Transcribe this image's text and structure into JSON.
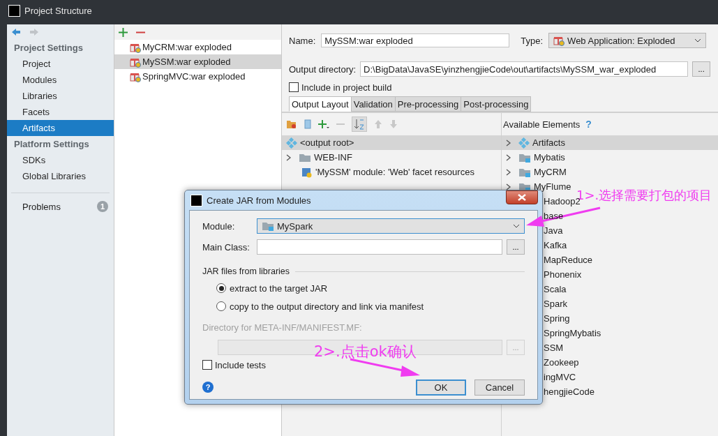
{
  "window": {
    "title": "Project Structure"
  },
  "sidebar": {
    "sections": [
      {
        "heading": "Project Settings",
        "items": [
          {
            "label": "Project",
            "selected": false
          },
          {
            "label": "Modules",
            "selected": false
          },
          {
            "label": "Libraries",
            "selected": false
          },
          {
            "label": "Facets",
            "selected": false
          },
          {
            "label": "Artifacts",
            "selected": true
          }
        ]
      },
      {
        "heading": "Platform Settings",
        "items": [
          {
            "label": "SDKs",
            "selected": false
          },
          {
            "label": "Global Libraries",
            "selected": false
          }
        ]
      }
    ],
    "problems": {
      "label": "Problems",
      "count": "1"
    }
  },
  "artifacts": [
    {
      "label": "MyCRM:war exploded",
      "selected": false
    },
    {
      "label": "MySSM:war exploded",
      "selected": true
    },
    {
      "label": "SpringMVC:war exploded",
      "selected": false
    }
  ],
  "editor": {
    "name_label": "Name:",
    "name": "MySSM:war exploded",
    "type_label": "Type:",
    "type": "Web Application: Exploded",
    "output_label": "Output directory:",
    "output": "D:\\BigData\\JavaSE\\yinzhengjieCode\\out\\artifacts\\MySSM_war_exploded",
    "browse": "...",
    "include_build": {
      "label": "Include in project build",
      "checked": false
    },
    "tabs": [
      {
        "label": "Output Layout",
        "selected": true
      },
      {
        "label": "Validation",
        "selected": false
      },
      {
        "label": "Pre-processing",
        "selected": false
      },
      {
        "label": "Post-processing",
        "selected": false
      }
    ],
    "layout_tree": [
      {
        "label": "<output root>",
        "kind": "root",
        "selected": true
      },
      {
        "label": "WEB-INF",
        "kind": "folder",
        "selected": false
      },
      {
        "label": "'MySSM' module: 'Web' facet resources",
        "kind": "facet",
        "selected": false
      }
    ],
    "available_title": "Available Elements",
    "help": "?",
    "available": [
      {
        "label": "Artifacts",
        "kind": "artifacts",
        "selected": true
      },
      {
        "label": "Mybatis",
        "kind": "module",
        "selected": false
      },
      {
        "label": "MyCRM",
        "kind": "module",
        "selected": false
      },
      {
        "label": "MyFlume",
        "kind": "module",
        "selected": false
      },
      {
        "label": "Hadoop2",
        "kind": "clipped"
      },
      {
        "label": "base",
        "kind": "clipped"
      },
      {
        "label": "Java",
        "kind": "clipped"
      },
      {
        "label": "Kafka",
        "kind": "clipped"
      },
      {
        "label": "MapReduce",
        "kind": "clipped"
      },
      {
        "label": "Phonenix",
        "kind": "clipped"
      },
      {
        "label": "Scala",
        "kind": "clipped"
      },
      {
        "label": "Spark",
        "kind": "clipped"
      },
      {
        "label": "Spring",
        "kind": "clipped"
      },
      {
        "label": "SpringMybatis",
        "kind": "clipped"
      },
      {
        "label": "SSM",
        "kind": "clipped"
      },
      {
        "label": "Zookeep",
        "kind": "clipped"
      },
      {
        "label": "ingMVC",
        "kind": "clipped"
      },
      {
        "label": "hengjieCode",
        "kind": "clipped"
      }
    ]
  },
  "dialog": {
    "title": "Create JAR from Modules",
    "module_label": "Module:",
    "module": "MySpark",
    "main_class_label": "Main Class:",
    "browse": "...",
    "libraries_heading": "JAR files from libraries",
    "options": [
      {
        "label": "extract to the target JAR",
        "selected": true
      },
      {
        "label": "copy to the output directory and link via manifest",
        "selected": false
      }
    ],
    "manifest": {
      "label": "Directory for META-INF/MANIFEST.MF:",
      "browse": "...",
      "disabled": true
    },
    "include_tests": {
      "label": "Include tests",
      "checked": false
    },
    "help": "?",
    "buttons": [
      {
        "label": "OK",
        "default": true
      },
      {
        "label": "Cancel",
        "default": false
      }
    ]
  },
  "annotations": [
    {
      "text": "1>.选择需要打包的项目"
    },
    {
      "text": "2>.点击ok确认"
    }
  ]
}
